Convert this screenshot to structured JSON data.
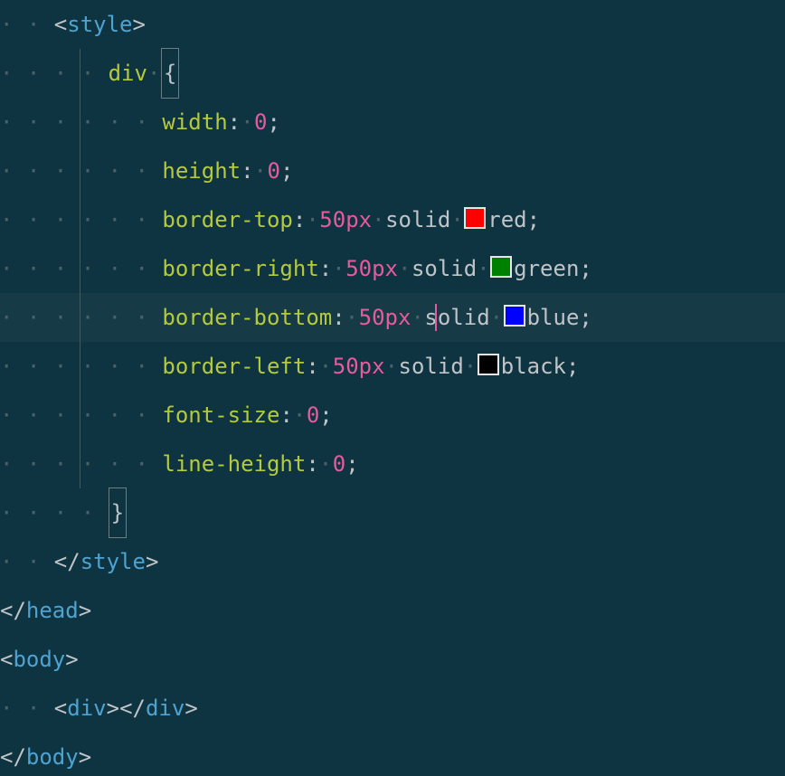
{
  "code": {
    "l1": {
      "ws": "· · ",
      "angle": "<",
      "tag": "style",
      "close": ">"
    },
    "l2": {
      "ws": "· · · · ",
      "selector": "div",
      "sp": "·",
      "brace": "{"
    },
    "l3": {
      "ws": "· · · · · · ",
      "prop": "width",
      "colon": ":",
      "sp": "·",
      "val": "0",
      "semi": ";"
    },
    "l4": {
      "ws": "· · · · · · ",
      "prop": "height",
      "colon": ":",
      "sp": "·",
      "val": "0",
      "semi": ";"
    },
    "l5": {
      "ws": "· · · · · · ",
      "prop": "border-top",
      "colon": ":",
      "sp": "·",
      "num": "50",
      "unit": "px",
      "sp2": "·",
      "style": "solid",
      "sp3": "·",
      "swatch": "#ff0000",
      "color": "red",
      "semi": ";"
    },
    "l6": {
      "ws": "· · · · · · ",
      "prop": "border-right",
      "colon": ":",
      "sp": "·",
      "num": "50",
      "unit": "px",
      "sp2": "·",
      "style": "solid",
      "sp3": "·",
      "swatch": "#008000",
      "color": "green",
      "semi": ";"
    },
    "l7": {
      "ws": "· · · · · · ",
      "prop": "border-bottom",
      "colon": ":",
      "sp": "·",
      "num": "50",
      "unit": "px",
      "sp2": "·",
      "style": "solid",
      "sp3": "·",
      "swatch": "#0000ff",
      "color": "blue",
      "semi": ";"
    },
    "l8": {
      "ws": "· · · · · · ",
      "prop": "border-left",
      "colon": ":",
      "sp": "·",
      "num": "50",
      "unit": "px",
      "sp2": "·",
      "style": "solid",
      "sp3": "·",
      "swatch": "#000000",
      "color": "black",
      "semi": ";"
    },
    "l9": {
      "ws": "· · · · · · ",
      "prop": "font-size",
      "colon": ":",
      "sp": "·",
      "val": "0",
      "semi": ";"
    },
    "l10": {
      "ws": "· · · · · · ",
      "prop": "line-height",
      "colon": ":",
      "sp": "·",
      "val": "0",
      "semi": ";"
    },
    "l11": {
      "ws": "· · · · ",
      "brace": "}"
    },
    "l12": {
      "ws": "· · ",
      "angle": "</",
      "tag": "style",
      "close": ">"
    },
    "l13": {
      "angle": "</",
      "tag": "head",
      "close": ">"
    },
    "l14": {
      "angle": "<",
      "tag": "body",
      "close": ">"
    },
    "l15": {
      "ws": "· · ",
      "angle1": "<",
      "tag1": "div",
      "close1": ">",
      "angle2": "</",
      "tag2": "div",
      "close2": ">"
    },
    "l16": {
      "angle": "</",
      "tag": "body",
      "close": ">"
    }
  }
}
